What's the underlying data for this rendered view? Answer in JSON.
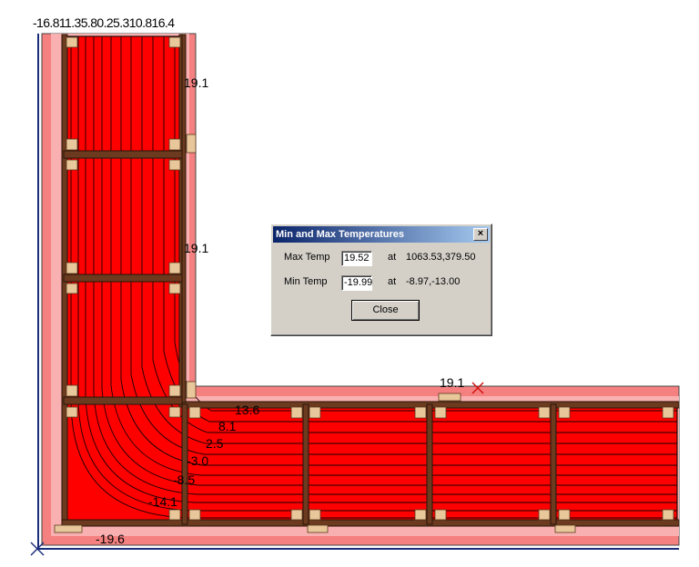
{
  "top_scale": {
    "text": "-16.811.35.80.25.310.816.4"
  },
  "contour_labels": {
    "a": "19.1",
    "b": "19.1",
    "c": "19.1",
    "d": "13.6",
    "e": "8.1",
    "f": "2.5",
    "g": "-3.0",
    "h": "-8.5",
    "i": "-14.1",
    "j": "-19.6"
  },
  "dialog": {
    "title": "Min and Max Temperatures",
    "close_x": "×",
    "max_label": "Max Temp",
    "max_value": "19.52",
    "max_at": "at",
    "max_coord": "1063.53,379.50",
    "min_label": "Min Temp",
    "min_value": "-19.99",
    "min_at": "at",
    "min_coord": "-8.97,-13.00",
    "close_button": "Close"
  },
  "colors": {
    "warm_fill": "#ff0000",
    "insulation": "#f58080",
    "frame": "#6b3a1f",
    "block": "#e8c89a",
    "boundary": "#1a2c7a"
  }
}
